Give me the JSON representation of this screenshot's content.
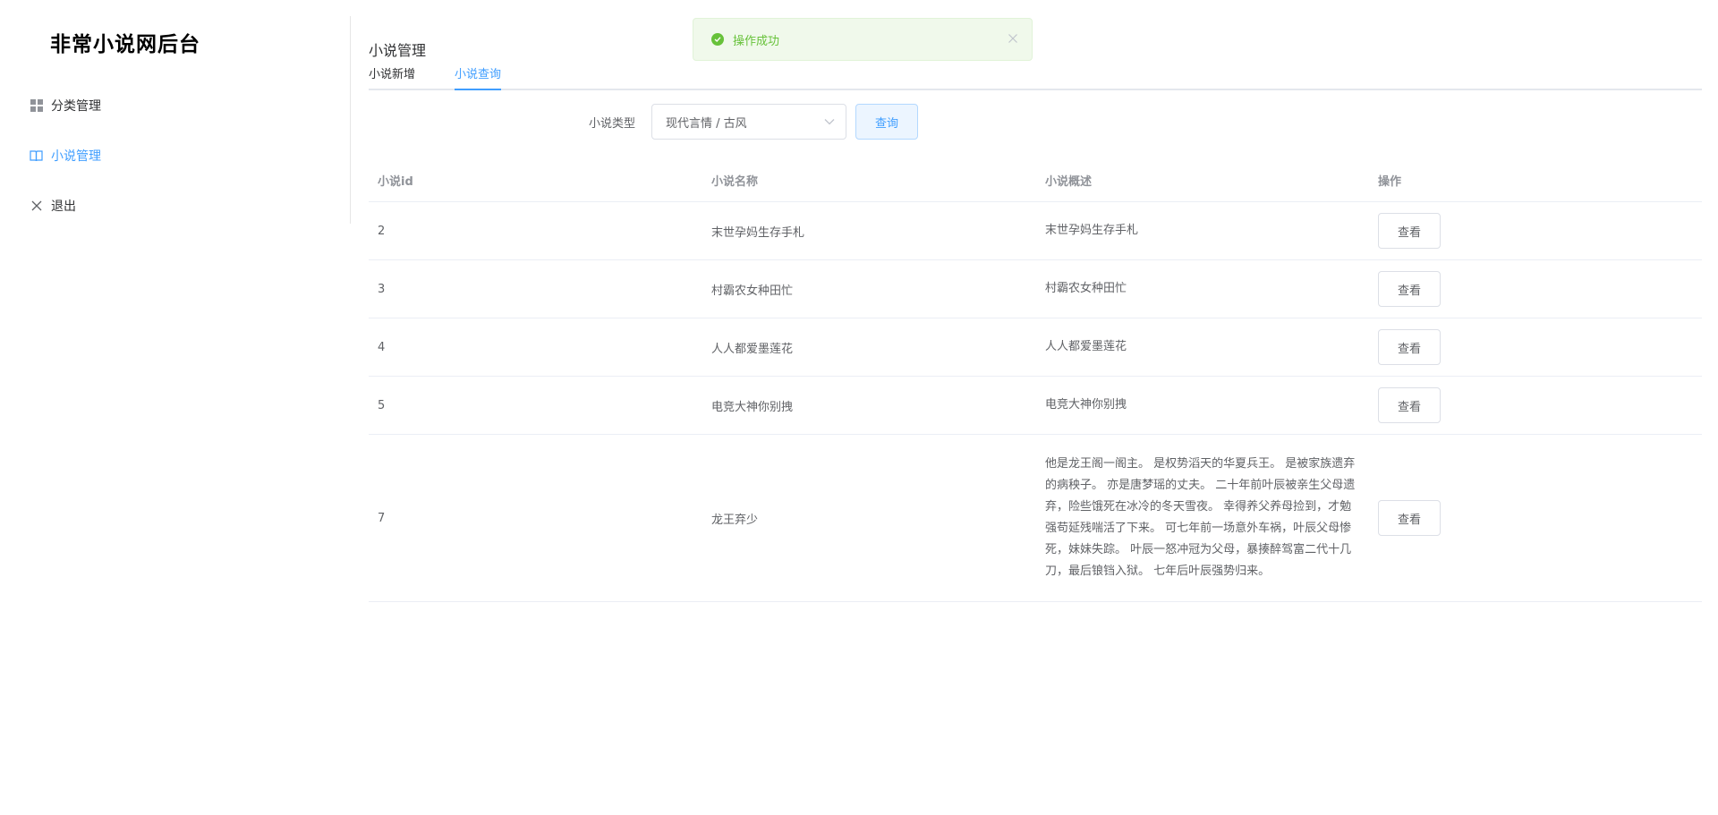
{
  "app": {
    "title": "非常小说网后台"
  },
  "sidebar": {
    "items": [
      {
        "label": "分类管理",
        "icon": "grid-icon"
      },
      {
        "label": "小说管理",
        "icon": "book-icon",
        "active": true
      },
      {
        "label": "退出",
        "icon": "close-icon"
      }
    ]
  },
  "toast": {
    "message": "操作成功",
    "type": "success",
    "color": "#67c23a"
  },
  "page": {
    "title": "小说管理",
    "tabs": [
      {
        "label": "小说新增"
      },
      {
        "label": "小说查询",
        "active": true
      }
    ]
  },
  "filter": {
    "label": "小说类型",
    "selected": "现代言情 / 古风",
    "query_button": "查询"
  },
  "table": {
    "headers": [
      "小说id",
      "小说名称",
      "小说概述",
      "操作"
    ],
    "rows": [
      {
        "id": "2",
        "name": "末世孕妈生存手札",
        "desc": "末世孕妈生存手札",
        "action": "查看"
      },
      {
        "id": "3",
        "name": "村霸农女种田忙",
        "desc": "村霸农女种田忙",
        "action": "查看"
      },
      {
        "id": "4",
        "name": "人人都爱墨莲花",
        "desc": "人人都爱墨莲花",
        "action": "查看"
      },
      {
        "id": "5",
        "name": "电竞大神你别拽",
        "desc": "电竞大神你别拽",
        "action": "查看"
      },
      {
        "id": "7",
        "name": "龙王弃少",
        "desc": "他是龙王阁一阁主。 是权势滔天的华夏兵王。 是被家族遗弃的病秧子。 亦是唐梦瑶的丈夫。 二十年前叶辰被亲生父母遗弃，险些饿死在冰冷的冬天雪夜。 幸得养父养母捡到，才勉强苟延残喘活了下来。 可七年前一场意外车祸，叶辰父母惨死，妹妹失踪。 叶辰一怒冲冠为父母，暴揍醉驾富二代十几刀，最后锒铛入狱。 七年后叶辰强势归来。",
        "action": "查看"
      }
    ]
  },
  "colors": {
    "accent": "#409eff",
    "success": "#67c23a",
    "border": "#ebeef5"
  }
}
